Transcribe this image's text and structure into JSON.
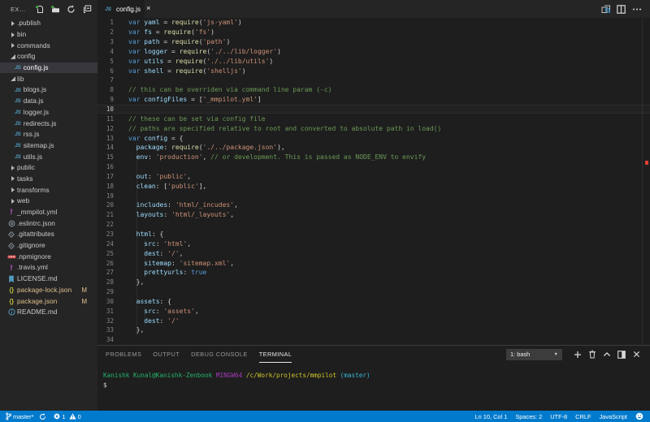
{
  "colors": {
    "editor_bg": "#1e1e1e",
    "sidebar_bg": "#252526",
    "statusbar_bg": "#007acc",
    "selected_row_bg": "#37373d",
    "git_modified": "#e2c08d",
    "syntax": {
      "keyword": "#569cd6",
      "variable": "#9cdcfe",
      "function": "#dcdcaa",
      "string": "#ce9178",
      "comment": "#6a9955",
      "punctuation": "#d4d4d4"
    },
    "js_icon": "#519aba",
    "json_icon": "#b7b73b",
    "yaml_icon": "#c65fd0",
    "npm_icon": "#cb3837",
    "error_marker": "#f44336"
  },
  "sidebar": {
    "title": "EXPLORER",
    "toolbar": [
      "new-file",
      "new-folder",
      "refresh-explorer",
      "collapse-folders"
    ],
    "tree": [
      {
        "label": ".publish",
        "kind": "folder",
        "depth": 0,
        "expanded": false
      },
      {
        "label": "bin",
        "kind": "folder",
        "depth": 0,
        "expanded": false
      },
      {
        "label": "commands",
        "kind": "folder",
        "depth": 0,
        "expanded": false
      },
      {
        "label": "config",
        "kind": "folder",
        "depth": 0,
        "expanded": true
      },
      {
        "label": "config.js",
        "kind": "file",
        "icon": "js",
        "depth": 1,
        "selected": true
      },
      {
        "label": "lib",
        "kind": "folder",
        "depth": 0,
        "expanded": true
      },
      {
        "label": "blogs.js",
        "kind": "file",
        "icon": "js",
        "depth": 1
      },
      {
        "label": "data.js",
        "kind": "file",
        "icon": "js",
        "depth": 1
      },
      {
        "label": "logger.js",
        "kind": "file",
        "icon": "js",
        "depth": 1
      },
      {
        "label": "redirects.js",
        "kind": "file",
        "icon": "js",
        "depth": 1
      },
      {
        "label": "rss.js",
        "kind": "file",
        "icon": "js",
        "depth": 1
      },
      {
        "label": "sitemap.js",
        "kind": "file",
        "icon": "js",
        "depth": 1
      },
      {
        "label": "utils.js",
        "kind": "file",
        "icon": "js",
        "depth": 1
      },
      {
        "label": "public",
        "kind": "folder",
        "depth": 0,
        "expanded": false
      },
      {
        "label": "tasks",
        "kind": "folder",
        "depth": 0,
        "expanded": false
      },
      {
        "label": "transforms",
        "kind": "folder",
        "depth": 0,
        "expanded": false
      },
      {
        "label": "web",
        "kind": "folder",
        "depth": 0,
        "expanded": false
      },
      {
        "label": "_mmpilot.yml",
        "kind": "file",
        "icon": "yaml",
        "depth": 0
      },
      {
        "label": ".eslintrc.json",
        "kind": "file",
        "icon": "eslint",
        "depth": 0
      },
      {
        "label": ".gitattributes",
        "kind": "file",
        "icon": "git",
        "depth": 0
      },
      {
        "label": ".gitignore",
        "kind": "file",
        "icon": "git",
        "depth": 0
      },
      {
        "label": ".npmignore",
        "kind": "file",
        "icon": "npm",
        "depth": 0
      },
      {
        "label": ".travis.yml",
        "kind": "file",
        "icon": "yaml",
        "depth": 0
      },
      {
        "label": "LICENSE.md",
        "kind": "file",
        "icon": "license",
        "depth": 0
      },
      {
        "label": "package-lock.json",
        "kind": "file",
        "icon": "json",
        "depth": 0,
        "git": "M"
      },
      {
        "label": "package.json",
        "kind": "file",
        "icon": "json",
        "depth": 0,
        "git": "M"
      },
      {
        "label": "README.md",
        "kind": "file",
        "icon": "info",
        "depth": 0
      }
    ]
  },
  "editor": {
    "tab": {
      "label": "config.js",
      "icon": "js",
      "close": "×"
    },
    "actions": [
      "open-changes",
      "split-editor",
      "more-actions"
    ],
    "current_line": 10,
    "lines": [
      {
        "n": 1,
        "t": [
          [
            "k",
            "var "
          ],
          [
            "v",
            "yaml"
          ],
          [
            "p",
            " = "
          ],
          [
            "f",
            "require"
          ],
          [
            "p",
            "("
          ],
          [
            "s",
            "'js-yaml'"
          ],
          [
            "p",
            ")"
          ]
        ]
      },
      {
        "n": 2,
        "t": [
          [
            "k",
            "var "
          ],
          [
            "v",
            "fs"
          ],
          [
            "p",
            " = "
          ],
          [
            "f",
            "require"
          ],
          [
            "p",
            "("
          ],
          [
            "s",
            "'fs'"
          ],
          [
            "p",
            ")"
          ]
        ]
      },
      {
        "n": 3,
        "t": [
          [
            "k",
            "var "
          ],
          [
            "v",
            "path"
          ],
          [
            "p",
            " = "
          ],
          [
            "f",
            "require"
          ],
          [
            "p",
            "("
          ],
          [
            "s",
            "'path'"
          ],
          [
            "p",
            ")"
          ]
        ]
      },
      {
        "n": 4,
        "t": [
          [
            "k",
            "var "
          ],
          [
            "v",
            "logger"
          ],
          [
            "p",
            " = "
          ],
          [
            "f",
            "require"
          ],
          [
            "p",
            "("
          ],
          [
            "s",
            "'./../lib/logger'"
          ],
          [
            "p",
            ")"
          ]
        ]
      },
      {
        "n": 5,
        "t": [
          [
            "k",
            "var "
          ],
          [
            "v",
            "utils"
          ],
          [
            "p",
            " = "
          ],
          [
            "f",
            "require"
          ],
          [
            "p",
            "("
          ],
          [
            "s",
            "'./../lib/utils'"
          ],
          [
            "p",
            ")"
          ]
        ]
      },
      {
        "n": 6,
        "t": [
          [
            "k",
            "var "
          ],
          [
            "v",
            "shell"
          ],
          [
            "p",
            " = "
          ],
          [
            "f",
            "require"
          ],
          [
            "p",
            "("
          ],
          [
            "s",
            "'shelljs'"
          ],
          [
            "p",
            ")"
          ]
        ]
      },
      {
        "n": 7,
        "t": []
      },
      {
        "n": 8,
        "t": [
          [
            "c",
            "// this can be overriden via command line param (-c)"
          ]
        ]
      },
      {
        "n": 9,
        "t": [
          [
            "k",
            "var "
          ],
          [
            "v",
            "configFiles"
          ],
          [
            "p",
            " = ["
          ],
          [
            "s",
            "'_mmpilot.yml'"
          ],
          [
            "p",
            "]"
          ]
        ]
      },
      {
        "n": 10,
        "t": []
      },
      {
        "n": 11,
        "t": [
          [
            "c",
            "// these can be set via config file"
          ]
        ]
      },
      {
        "n": 12,
        "t": [
          [
            "c",
            "// paths are specified relative to root and converted to absolute path in load()"
          ]
        ]
      },
      {
        "n": 13,
        "t": [
          [
            "k",
            "var "
          ],
          [
            "v",
            "config"
          ],
          [
            "p",
            " = {"
          ]
        ]
      },
      {
        "n": 14,
        "t": [
          [
            "p",
            "  "
          ],
          [
            "v",
            "package"
          ],
          [
            "p",
            ": "
          ],
          [
            "f",
            "require"
          ],
          [
            "p",
            "("
          ],
          [
            "s",
            "'./../package.json'"
          ],
          [
            "p",
            "),"
          ]
        ]
      },
      {
        "n": 15,
        "t": [
          [
            "p",
            "  "
          ],
          [
            "v",
            "env"
          ],
          [
            "p",
            ": "
          ],
          [
            "s",
            "'production'"
          ],
          [
            "p",
            ", "
          ],
          [
            "c",
            "// or development. This is passed as NODE_ENV to envify"
          ]
        ]
      },
      {
        "n": 16,
        "t": []
      },
      {
        "n": 17,
        "t": [
          [
            "p",
            "  "
          ],
          [
            "v",
            "out"
          ],
          [
            "p",
            ": "
          ],
          [
            "s",
            "'public'"
          ],
          [
            "p",
            ","
          ]
        ]
      },
      {
        "n": 18,
        "t": [
          [
            "p",
            "  "
          ],
          [
            "v",
            "clean"
          ],
          [
            "p",
            ": ["
          ],
          [
            "s",
            "'public'"
          ],
          [
            "p",
            "],"
          ]
        ]
      },
      {
        "n": 19,
        "t": []
      },
      {
        "n": 20,
        "t": [
          [
            "p",
            "  "
          ],
          [
            "v",
            "includes"
          ],
          [
            "p",
            ": "
          ],
          [
            "s",
            "'html/_incudes'"
          ],
          [
            "p",
            ","
          ]
        ]
      },
      {
        "n": 21,
        "t": [
          [
            "p",
            "  "
          ],
          [
            "v",
            "layouts"
          ],
          [
            "p",
            ": "
          ],
          [
            "s",
            "'html/_layouts'"
          ],
          [
            "p",
            ","
          ]
        ]
      },
      {
        "n": 22,
        "t": []
      },
      {
        "n": 23,
        "t": [
          [
            "p",
            "  "
          ],
          [
            "v",
            "html"
          ],
          [
            "p",
            ": {"
          ]
        ]
      },
      {
        "n": 24,
        "t": [
          [
            "p",
            "    "
          ],
          [
            "v",
            "src"
          ],
          [
            "p",
            ": "
          ],
          [
            "s",
            "'html'"
          ],
          [
            "p",
            ","
          ]
        ]
      },
      {
        "n": 25,
        "t": [
          [
            "p",
            "    "
          ],
          [
            "v",
            "dest"
          ],
          [
            "p",
            ": "
          ],
          [
            "s",
            "'/'"
          ],
          [
            "p",
            ","
          ]
        ]
      },
      {
        "n": 26,
        "t": [
          [
            "p",
            "    "
          ],
          [
            "v",
            "sitemap"
          ],
          [
            "p",
            ": "
          ],
          [
            "s",
            "'sitemap.xml'"
          ],
          [
            "p",
            ","
          ]
        ]
      },
      {
        "n": 27,
        "t": [
          [
            "p",
            "    "
          ],
          [
            "v",
            "prettyurls"
          ],
          [
            "p",
            ": "
          ],
          [
            "k",
            "true"
          ]
        ]
      },
      {
        "n": 28,
        "t": [
          [
            "p",
            "  },"
          ]
        ]
      },
      {
        "n": 29,
        "t": []
      },
      {
        "n": 30,
        "t": [
          [
            "p",
            "  "
          ],
          [
            "v",
            "assets"
          ],
          [
            "p",
            ": {"
          ]
        ]
      },
      {
        "n": 31,
        "t": [
          [
            "p",
            "    "
          ],
          [
            "v",
            "src"
          ],
          [
            "p",
            ": "
          ],
          [
            "s",
            "'assets'"
          ],
          [
            "p",
            ","
          ]
        ]
      },
      {
        "n": 32,
        "t": [
          [
            "p",
            "    "
          ],
          [
            "v",
            "dest"
          ],
          [
            "p",
            ": "
          ],
          [
            "s",
            "'/'"
          ]
        ]
      },
      {
        "n": 33,
        "t": [
          [
            "p",
            "  },"
          ]
        ]
      },
      {
        "n": 34,
        "t": []
      }
    ]
  },
  "panel": {
    "tabs": [
      {
        "label": "PROBLEMS",
        "active": false
      },
      {
        "label": "OUTPUT",
        "active": false
      },
      {
        "label": "DEBUG CONSOLE",
        "active": false
      },
      {
        "label": "TERMINAL",
        "active": true
      }
    ],
    "terminal_select": "1: bash",
    "actions": [
      "new-terminal",
      "kill-terminal",
      "maximize-panel",
      "split-terminal",
      "close-panel"
    ],
    "terminal_lines": [
      [
        [
          "green",
          "Kanishk Kunal@Kanishk-Zenbook"
        ],
        [
          "plain",
          " "
        ],
        [
          "magenta",
          "MINGW64"
        ],
        [
          "plain",
          " "
        ],
        [
          "yellow",
          "/c/Work/projects/mmpilot"
        ],
        [
          "plain",
          " "
        ],
        [
          "cyan",
          "(master)"
        ]
      ],
      [
        [
          "plain",
          "$"
        ]
      ]
    ]
  },
  "statusbar": {
    "branch": "master*",
    "errors": "1",
    "warnings": "0",
    "right_items": [
      "Ln 10, Col 1",
      "Spaces: 2",
      "UTF-8",
      "CRLF",
      "JavaScript"
    ]
  }
}
